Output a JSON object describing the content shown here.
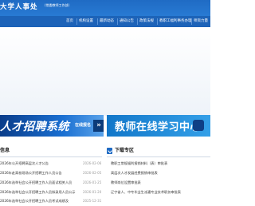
{
  "header": {
    "title": "大学人事处",
    "subtitle": "(常委教师工作部)"
  },
  "nav": {
    "items": [
      {
        "label": "首页"
      },
      {
        "label": "机构设置"
      },
      {
        "label": "最新动态"
      },
      {
        "label": "通知公告"
      },
      {
        "label": "政策法规"
      },
      {
        "label": "教职工福利事务办理"
      },
      {
        "label": "师资力量"
      }
    ]
  },
  "banners": {
    "left": {
      "text": "人才招聘系统",
      "link": "在线报名"
    },
    "right": {
      "text": "教师在线学习中心"
    }
  },
  "notices": {
    "title": "信息",
    "items": [
      {
        "title": "2026年公开招聘高层次人才公告",
        "date": "2026-02-06"
      },
      {
        "title": "2026年赴高校现场公开招聘工作人员公告",
        "date": "2026-02-05"
      },
      {
        "title": "2026年选举社会公开招聘工作人员面试相关人员",
        "date": "2026-01-25"
      },
      {
        "title": "2026年选举社会公开招聘工作人员拟录用人员公示",
        "date": "2026-01-20"
      },
      {
        "title": "2026年选举社会公开招聘工作人员考试成绩及",
        "date": "2025-12-31"
      }
    ]
  },
  "downloads": {
    "title": "下载专区",
    "items": [
      {
        "title": "教职工常规福利报销材料（表）审批表"
      },
      {
        "title": "高层次人才发展经费报销审批表"
      },
      {
        "title": "教师岗位设置审批表"
      },
      {
        "title": "辽宁省人、中专毕业生派遣专业技术职务审批表"
      }
    ]
  }
}
